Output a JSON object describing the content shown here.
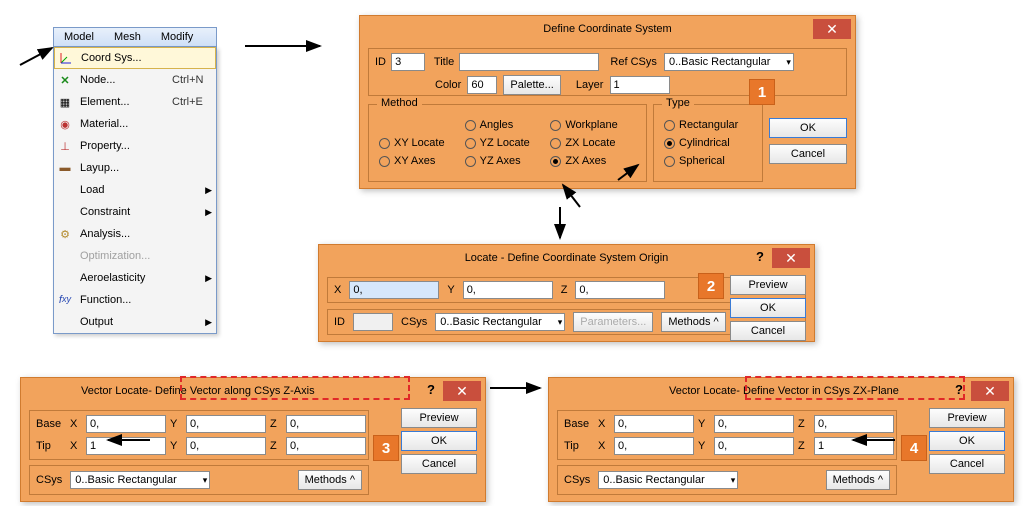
{
  "menubar": {
    "items": [
      "Model",
      "Mesh",
      "Modify"
    ]
  },
  "dropdown": {
    "items": [
      {
        "label": "Coord Sys...",
        "shortcut": "",
        "selected": true
      },
      {
        "label": "Node...",
        "shortcut": "Ctrl+N"
      },
      {
        "label": "Element...",
        "shortcut": "Ctrl+E"
      },
      {
        "label": "Material..."
      },
      {
        "label": "Property..."
      },
      {
        "label": "Layup..."
      },
      {
        "label": "Load",
        "submenu": true
      },
      {
        "label": "Constraint",
        "submenu": true
      },
      {
        "label": "Analysis..."
      },
      {
        "label": "Optimization...",
        "disabled": true
      },
      {
        "label": "Aeroelasticity",
        "submenu": true
      },
      {
        "label": "Function..."
      },
      {
        "label": "Output",
        "submenu": true
      }
    ]
  },
  "dlg1": {
    "title": "Define Coordinate System",
    "id_label": "ID",
    "id_value": "3",
    "title_label": "Title",
    "title_value": "",
    "refcsys_label": "Ref CSys",
    "refcsys_value": "0..Basic Rectangular",
    "color_label": "Color",
    "color_value": "60",
    "palette": "Palette...",
    "layer_label": "Layer",
    "layer_value": "1",
    "method_title": "Method",
    "method_options": [
      "Angles",
      "Workplane",
      "XY Locate",
      "YZ Locate",
      "ZX Locate",
      "XY Axes",
      "YZ Axes",
      "ZX Axes"
    ],
    "method_selected": "ZX Axes",
    "type_title": "Type",
    "type_options": [
      "Rectangular",
      "Cylindrical",
      "Spherical"
    ],
    "type_selected": "Cylindrical",
    "ok": "OK",
    "cancel": "Cancel"
  },
  "dlg2": {
    "title": "Locate - Define Coordinate System Origin",
    "x": "0,",
    "y": "0,",
    "z": "0,",
    "x_label": "X",
    "y_label": "Y",
    "z_label": "Z",
    "id_label": "ID",
    "csys_label": "CSys",
    "csys_value": "0..Basic Rectangular",
    "params": "Parameters...",
    "methods": "Methods ^",
    "preview": "Preview",
    "ok": "OK",
    "cancel": "Cancel"
  },
  "dlg3": {
    "title_prefix": "Vector Locate ",
    "title_suffix": "- Define Vector along CSys Z-Axis",
    "base": "Base",
    "tip": "Tip",
    "x_label": "X",
    "y_label": "Y",
    "z_label": "Z",
    "base_x": "0,",
    "base_y": "0,",
    "base_z": "0,",
    "tip_x": "1",
    "tip_y": "0,",
    "tip_z": "0,",
    "csys_label": "CSys",
    "csys_value": "0..Basic Rectangular",
    "methods": "Methods ^",
    "preview": "Preview",
    "ok": "OK",
    "cancel": "Cancel"
  },
  "dlg4": {
    "title_prefix": "Vector Locate ",
    "title_suffix": "- Define Vector in CSys ZX-Plane",
    "base": "Base",
    "tip": "Tip",
    "x_label": "X",
    "y_label": "Y",
    "z_label": "Z",
    "base_x": "0,",
    "base_y": "0,",
    "base_z": "0,",
    "tip_x": "0,",
    "tip_y": "0,",
    "tip_z": "1",
    "csys_label": "CSys",
    "csys_value": "0..Basic Rectangular",
    "methods": "Methods ^",
    "preview": "Preview",
    "ok": "OK",
    "cancel": "Cancel"
  },
  "markers": {
    "m1": "1",
    "m2": "2",
    "m3": "3",
    "m4": "4"
  }
}
